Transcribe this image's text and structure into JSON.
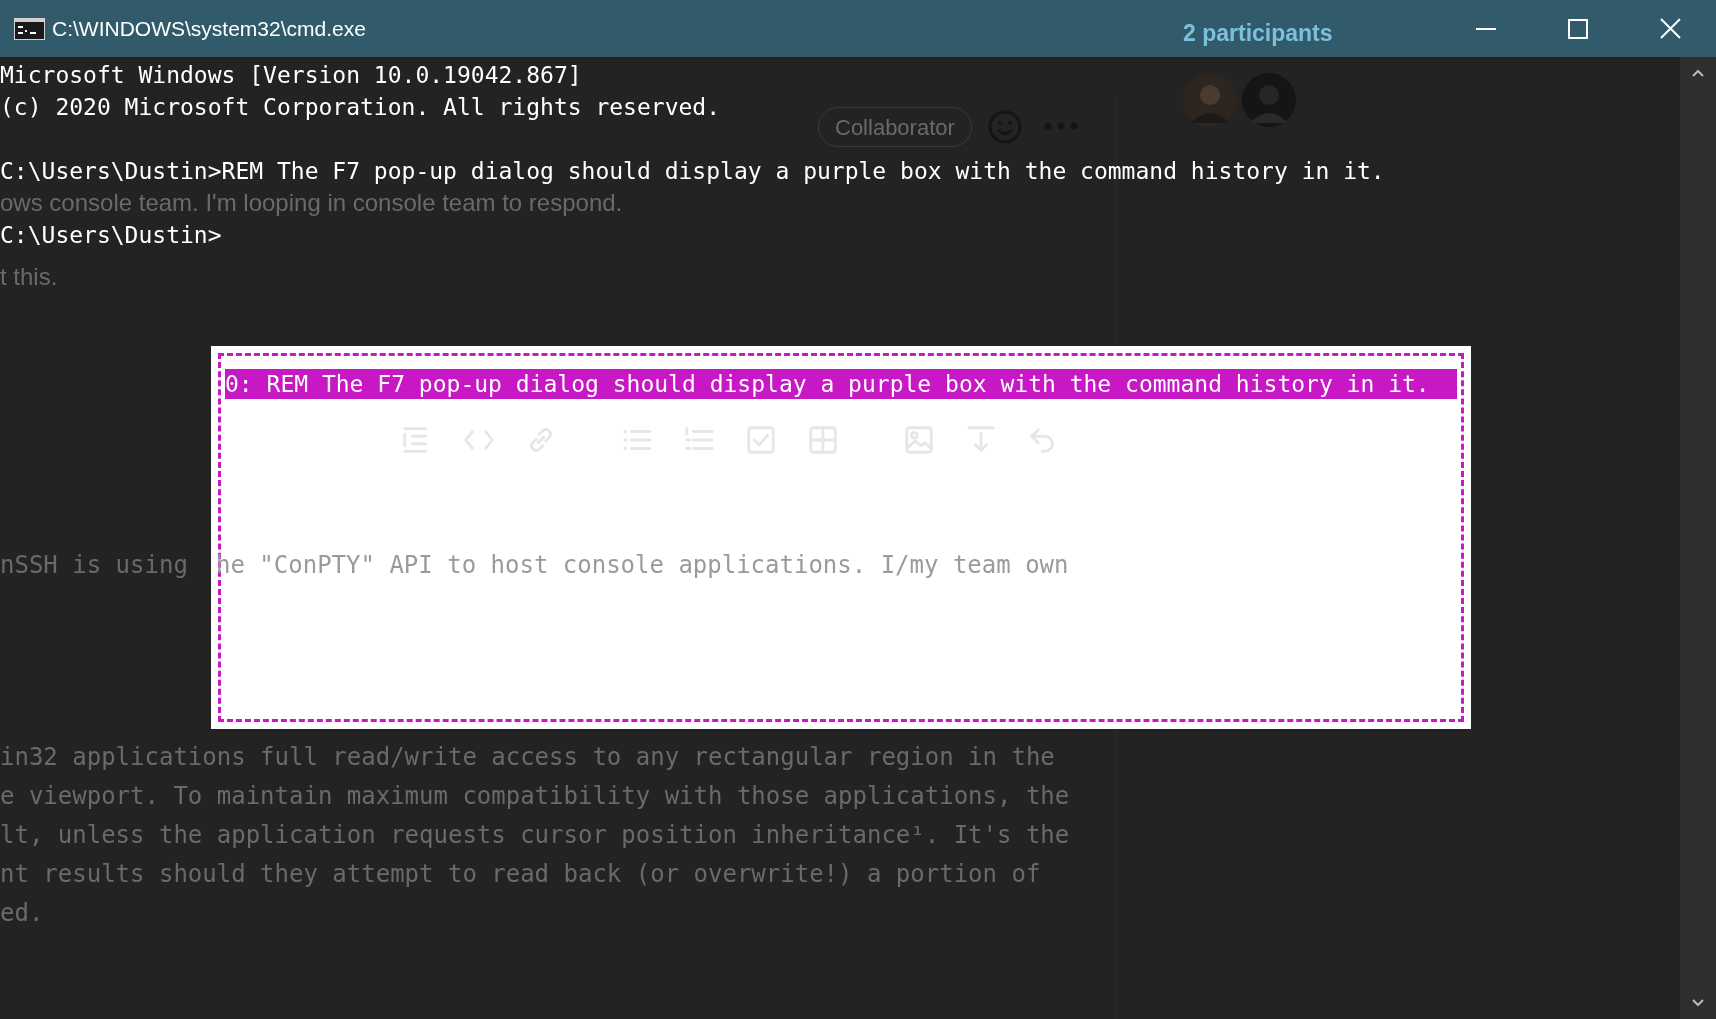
{
  "window": {
    "title": "C:\\WINDOWS\\system32\\cmd.exe"
  },
  "console_blocks": [
    [
      "Microsoft Windows [Version 10.0.19042.867]",
      "(c) 2020 Microsoft Corporation. All rights reserved."
    ],
    [
      "C:\\Users\\Dustin>REM The F7 pop-up dialog should display a purple box with the command history in it."
    ],
    [
      "C:\\Users\\Dustin>"
    ]
  ],
  "history_popup": {
    "items": [
      {
        "label": "0: REM The F7 pop-up dialog should display a purple box with the command history in it.",
        "selected": true
      }
    ]
  },
  "background_window": {
    "participants": "2 participants",
    "role_badge": "Collaborator",
    "comment_lines": [
      "ows console team. I'm looping in console team to respond.",
      "t this."
    ],
    "editor_text_outside": "nSSH is using",
    "editor_text_inside": "he \"ConPTY\" API to host console applications. I/my team own",
    "paragraph_lines": [
      "in32 applications full read/write access to any rectangular region in the",
      "e viewport. To maintain maximum compatibility with those applications, the",
      "lt, unless the application requests cursor position inheritance¹. It's the",
      "nt results should they attempt to read back (or overwrite!) a portion of",
      "ed."
    ]
  }
}
